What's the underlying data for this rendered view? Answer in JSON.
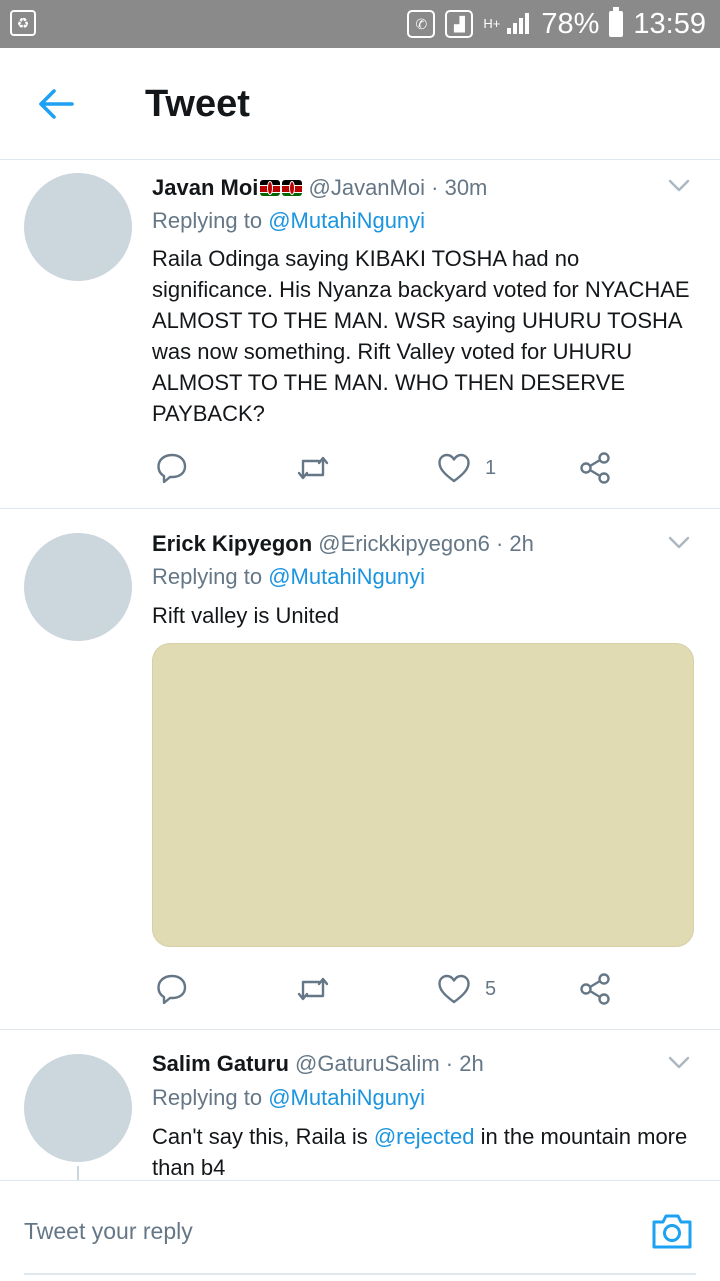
{
  "status_bar": {
    "battery": "78%",
    "time": "13:59",
    "network": "H+"
  },
  "header": {
    "title": "Tweet"
  },
  "colors": {
    "accent": "#1da1f2",
    "mention": "#1b95e0",
    "secondary_text": "#657786",
    "avatar_placeholder": "#ccd6dd",
    "media_placeholder": "#e1dbb4"
  },
  "tweets": [
    {
      "name": "Javan Moi",
      "flags": "kenya-flag-icon x2",
      "handle": "@JavanMoi",
      "time": "30m",
      "replying_prefix": "Replying to",
      "replying_to": "@MutahiNgunyi",
      "text": "Raila Odinga saying KIBAKI TOSHA had no significance. His Nyanza backyard voted for NYACHAE ALMOST TO THE MAN. WSR saying UHURU TOSHA was now something. Rift Valley voted for UHURU ALMOST TO THE MAN. WHO THEN DESERVE PAYBACK?",
      "likes": "1"
    },
    {
      "name": "Erick Kipyegon",
      "handle": "@Erickkipyegon6",
      "time": "2h",
      "replying_prefix": "Replying to",
      "replying_to": "@MutahiNgunyi",
      "text": "Rift valley is United",
      "likes": "5"
    },
    {
      "name": "Salim Gaturu",
      "handle": "@GaturuSalim",
      "time": "2h",
      "replying_prefix": "Replying to",
      "replying_to": "@MutahiNgunyi",
      "text_before": "Can't say this, Raila is ",
      "text_mention": "@rejected",
      "text_after": " in the mountain more than b4"
    }
  ],
  "separator": "·",
  "reply_bar": {
    "placeholder": "Tweet your reply"
  }
}
